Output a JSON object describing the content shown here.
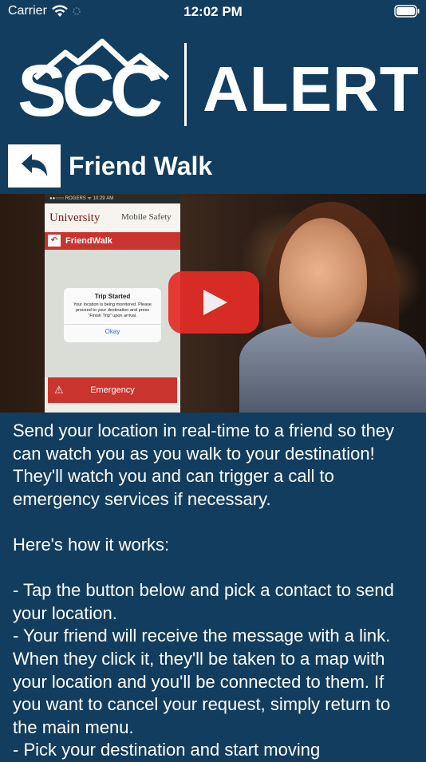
{
  "status_bar": {
    "carrier": "Carrier",
    "time": "12:02 PM"
  },
  "logo": {
    "left_text": "SCC",
    "right_text": "ALERT"
  },
  "page": {
    "title": "Friend Walk"
  },
  "video": {
    "phone": {
      "status": "●●○○○ ROGERS  ᯤ     10:29 AM",
      "header_logo": "University",
      "header_right": "Mobile Safety",
      "nav_title": "FriendWalk",
      "dialog_title": "Trip Started",
      "dialog_body": "Your location is being monitored. Please proceed to your destination and press \"Finish Trip\" upon arrival.",
      "dialog_okay": "Okay",
      "emergency_label": "Emergency"
    }
  },
  "description": "Send your location in real-time to a friend so they can watch you as you walk to your destination! They'll watch you and can trigger a call to emergency services if necessary.\n\nHere's how it works:\n\n- Tap the button below and pick a contact to send your location.\n- Your friend will receive the message with a link. When they click it, they'll be taken to a map with your location and you'll be connected to them. If you want to cancel your request, simply return to the main menu.\n- Pick your destination and start moving",
  "colors": {
    "background": "#123d5e",
    "text": "#ffffff",
    "play_button": "#e52d27"
  },
  "icons": {
    "back": "back-arrow-icon",
    "play": "play-icon",
    "wifi": "wifi-icon",
    "battery": "battery-icon"
  }
}
